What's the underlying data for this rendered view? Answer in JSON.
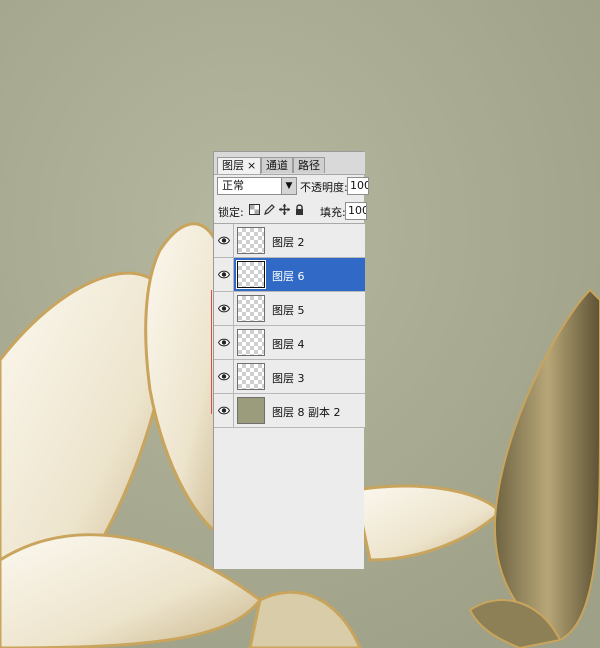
{
  "panel": {
    "tabs": [
      {
        "label": "图层",
        "close": "×",
        "active": true
      },
      {
        "label": "通道",
        "active": false
      },
      {
        "label": "路径",
        "active": false
      }
    ],
    "blend_mode": "正常",
    "opacity_label": "不透明度:",
    "opacity_value": "100",
    "lock_label": "锁定:",
    "fill_label": "填充:",
    "fill_value": "100",
    "lock_icons": [
      "lock-transparent-icon",
      "lock-image-icon",
      "lock-position-icon",
      "lock-all-icon"
    ],
    "layers": [
      {
        "name": "图层 2",
        "thumb": "transparent",
        "selected": false
      },
      {
        "name": "图层 6",
        "thumb": "transparent",
        "selected": true
      },
      {
        "name": "图层 5",
        "thumb": "transparent",
        "selected": false
      },
      {
        "name": "图层 4",
        "thumb": "transparent",
        "selected": false
      },
      {
        "name": "图层 3",
        "thumb": "transparent",
        "selected": false
      },
      {
        "name": "图层 8 副本 2",
        "thumb": "solid",
        "selected": false
      }
    ]
  },
  "colors": {
    "background": "#a9ab93",
    "selection": "#3169c6",
    "petal": "#f4efe2",
    "petal_rim": "#c9a45c",
    "bud": "#8b7d5a"
  }
}
